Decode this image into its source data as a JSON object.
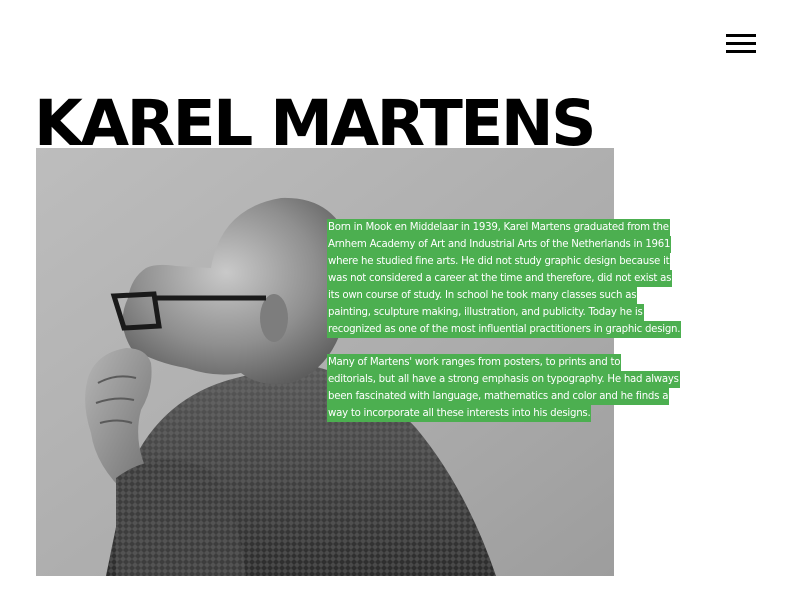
{
  "header": {
    "title": "KAREL MARTENS",
    "menu_icon": "hamburger-menu-icon"
  },
  "portrait": {
    "subject": "Karel Martens",
    "style": "black-and-white photograph"
  },
  "bio": {
    "highlight_color": "#4caf50",
    "text_color": "#ffffff",
    "paragraph_1": [
      "Born in Mook en Middelaar in 1939, Karel Martens graduated from the",
      "Arnhem Academy of Art and Industrial Arts of the Netherlands in 1961",
      "where he studied fine arts. He did not study graphic design because it",
      "was not considered a career at the time and therefore, did not exist as",
      "its own course of study. In school he took many classes such as",
      "painting, sculpture making, illustration, and publicity. Today he is",
      "recognized as one of the most influential practitioners in graphic design."
    ],
    "paragraph_2": [
      "Many of Martens' work ranges from posters, to prints and to",
      "editorials, but all have a strong emphasis on typography. He had always",
      "been fascinated with language, mathematics and color and he finds a",
      "way to incorporate all these interests into his designs."
    ]
  }
}
